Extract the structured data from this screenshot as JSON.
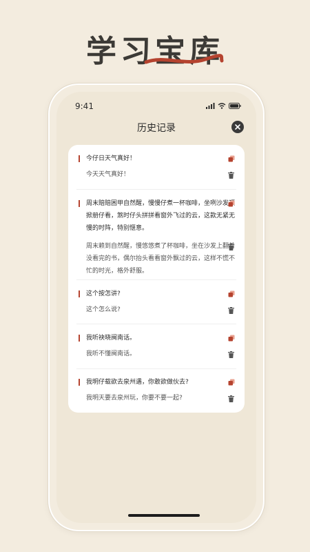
{
  "hero": {
    "title": "学习宝库"
  },
  "status_bar": {
    "time": "9:41"
  },
  "header": {
    "title": "历史记录"
  },
  "colors": {
    "accent": "#b5432f",
    "background": "#efe7d7",
    "card": "#ffffff"
  },
  "icons": {
    "copy": "copy-icon",
    "delete": "trash-icon",
    "close": "close-icon"
  },
  "history": [
    {
      "original": "今仔日天气真好！",
      "translation": "今天天气真好！"
    },
    {
      "original": "周末賠賠困甲自然醒，慢慢仔煮一杯咖啡，坐咧沙发顶掀册仔看，煞时仔头拼拼看窗外飞过的云，这款无紧无慢的时阵，特别惬意。",
      "translation": "周末赖到自然醒，慢悠悠煮了杯咖啡，坐在沙发上翻着没看完的书，偶尔抬头看看窗外飘过的云，这样不慌不忙的时光，格外舒服。"
    },
    {
      "original": "这个按怎讲?",
      "translation": "这个怎么说?"
    },
    {
      "original": "我听袂晓闽南话。",
      "translation": "我听不懂闽南话。"
    },
    {
      "original": "我明仔载欲去泉州遇，你敢欲做伙去?",
      "translation": "我明天要去泉州玩，你要不要一起?"
    }
  ]
}
